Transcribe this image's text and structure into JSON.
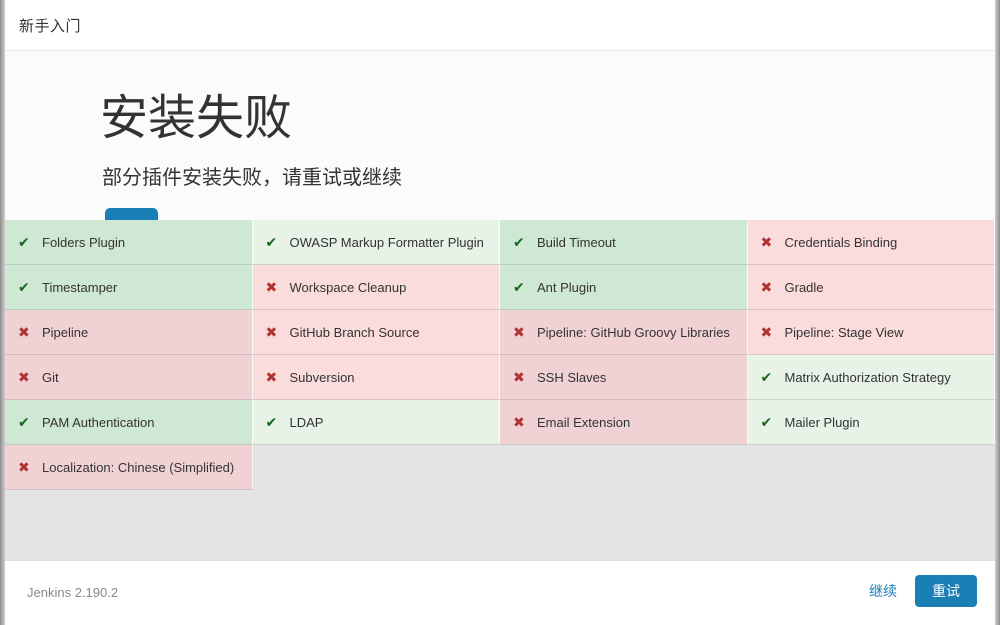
{
  "header": {
    "title": "新手入门"
  },
  "main": {
    "heading": "安装失败",
    "subtitle": "部分插件安装失败，请重试或继续"
  },
  "icons": {
    "check": "✔",
    "cross": "✖"
  },
  "colors": {
    "accent": "#1a7fb5",
    "success_text": "#19661e",
    "failure_text": "#b03434",
    "success_bg": "#e6f3e6",
    "success_bg_deep": "#cfe8d3",
    "failure_bg": "#fbdcdc",
    "failure_bg_deep": "#f1d2d4",
    "grid_bg": "#e4e4e4"
  },
  "plugins": [
    {
      "name": "Folders Plugin",
      "status": "success"
    },
    {
      "name": "OWASP Markup Formatter Plugin",
      "status": "success"
    },
    {
      "name": "Build Timeout",
      "status": "success"
    },
    {
      "name": "Credentials Binding",
      "status": "failure"
    },
    {
      "name": "Timestamper",
      "status": "success"
    },
    {
      "name": "Workspace Cleanup",
      "status": "failure"
    },
    {
      "name": "Ant Plugin",
      "status": "success"
    },
    {
      "name": "Gradle",
      "status": "failure"
    },
    {
      "name": "Pipeline",
      "status": "failure"
    },
    {
      "name": "GitHub Branch Source",
      "status": "failure"
    },
    {
      "name": "Pipeline: GitHub Groovy Libraries",
      "status": "failure"
    },
    {
      "name": "Pipeline: Stage View",
      "status": "failure"
    },
    {
      "name": "Git",
      "status": "failure"
    },
    {
      "name": "Subversion",
      "status": "failure"
    },
    {
      "name": "SSH Slaves",
      "status": "failure"
    },
    {
      "name": "Matrix Authorization Strategy",
      "status": "success"
    },
    {
      "name": "PAM Authentication",
      "status": "success"
    },
    {
      "name": "LDAP",
      "status": "success"
    },
    {
      "name": "Email Extension",
      "status": "failure"
    },
    {
      "name": "Mailer Plugin",
      "status": "success"
    },
    {
      "name": "Localization: Chinese (Simplified)",
      "status": "failure"
    }
  ],
  "footer": {
    "version": "Jenkins 2.190.2",
    "continue_label": "继续",
    "retry_label": "重试"
  }
}
